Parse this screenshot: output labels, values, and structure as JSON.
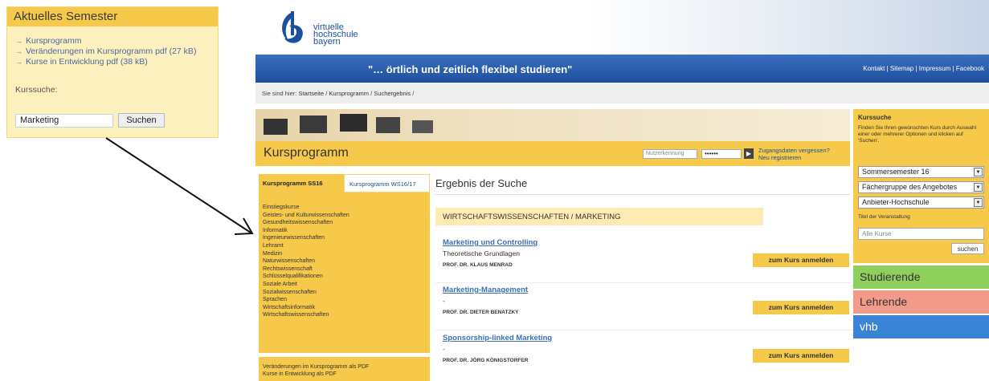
{
  "callout": {
    "title": "Aktuelles Semester",
    "links": [
      "Kursprogramm",
      "Veränderungen im Kursprogramm pdf (27 kB)",
      "Kurse in Entwicklung pdf (38 kB)"
    ],
    "search_label": "Kurssuche:",
    "search_value": "Marketing",
    "search_button": "Suchen"
  },
  "site": {
    "logo_text": [
      "virtuelle",
      "hochschule",
      "bayern"
    ],
    "slogan": "\"… örtlich und zeitlich flexibel studieren\"",
    "top_links": "Kontakt | Sitemap | Impressum | Facebook",
    "breadcrumb_prefix": "Sie sind hier:",
    "breadcrumb": [
      "Startseite",
      "Kursprogramm",
      "Suchergebnis"
    ],
    "section_title": "Kursprogramm",
    "login_placeholder": "Nutzerkennung",
    "password_mask": "••••••",
    "login_go": "▶",
    "forgot": "Zugangsdaten vergessen?",
    "register": "Neu registrieren"
  },
  "nav": {
    "tab_active": "Kursprogramm SS16",
    "tab_other": "Kursprogramm WS16/17",
    "items": [
      "Einstiegskurse",
      "Geistes- und Kulturwissenschaften",
      "Gesundheitswissenschaften",
      "Informatik",
      "Ingenieurwissenschaften",
      "Lehramt",
      "Medizin",
      "Naturwissenschaften",
      "Rechtswissenschaft",
      "Schlüsselqualifikationen",
      "Soziale Arbeit",
      "Sozialwissenschaften",
      "Sprachen",
      "Wirtschaftsinformatik",
      "Wirtschaftswissenschaften"
    ],
    "extra": [
      "Veränderungen im Kursprogramm als PDF",
      "Kurse in Entwicklung als PDF"
    ]
  },
  "results": {
    "title": "Ergebnis der Suche",
    "category": "WIRTSCHAFTSWISSENSCHAFTEN / MARKETING",
    "button": "zum Kurs anmelden",
    "items": [
      {
        "title": "Marketing und Controlling",
        "subtitle": "Theoretische Grundlagen",
        "prof": "PROF. DR. KLAUS MENRAD"
      },
      {
        "title": "Marketing-Management",
        "subtitle": "-",
        "prof": "PROF. DR. DIETER BENATZKY"
      },
      {
        "title": "Sponsorship-linked Marketing",
        "subtitle": "-",
        "prof": "PROF. DR. JÖRG KÖNIGSTORFER"
      }
    ]
  },
  "sidebar": {
    "title": "Kurssuche",
    "desc": "Finden Sie Ihren gewünschten Kurs durch Auswahl einer oder mehrerer Optionen und klicken auf 'Suchen'.",
    "selects": [
      "Sommersemester 16",
      "Fächergruppe des Angebotes",
      "Anbieter-Hochschule"
    ],
    "title_label": "Titel der Veranstaltung",
    "title_placeholder": "Alle Kurse",
    "search_button": "suchen",
    "boxes": [
      {
        "label": "Studierende",
        "color": "#8fcf5c"
      },
      {
        "label": "Lehrende",
        "color": "#f39b8b"
      },
      {
        "label": "vhb",
        "color": "#3a84d6"
      }
    ]
  }
}
